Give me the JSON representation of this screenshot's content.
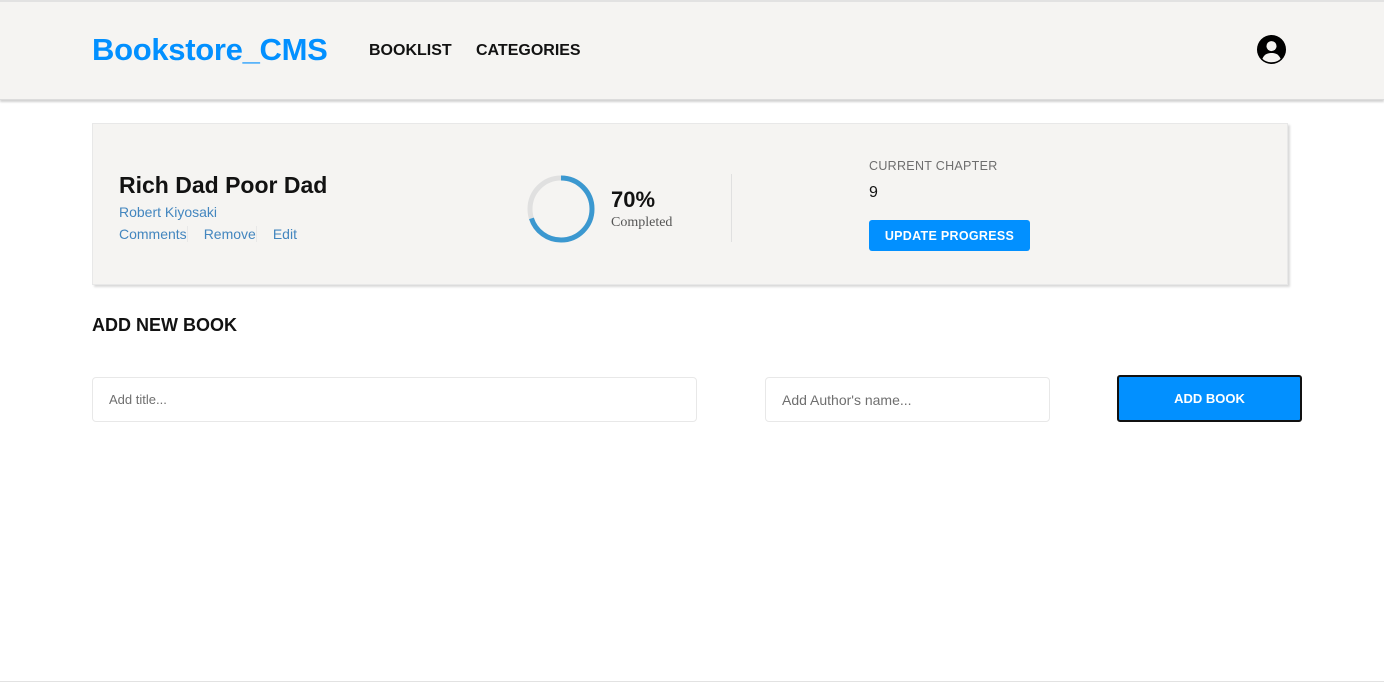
{
  "header": {
    "logo": "Bookstore_CMS",
    "nav": {
      "booklist": "BOOKLIST",
      "categories": "CATEGORIES"
    },
    "user_icon": "user-circle-icon"
  },
  "book": {
    "title": "Rich Dad Poor Dad",
    "author": "Robert Kiyosaki",
    "actions": {
      "comments": "Comments",
      "remove": "Remove",
      "edit": "Edit"
    },
    "progress": {
      "percent_text": "70%",
      "percent": 70,
      "label": "Completed"
    },
    "chapter": {
      "label": "CURRENT CHAPTER",
      "value": "9"
    },
    "update_button": "UPDATE PROGRESS"
  },
  "add_form": {
    "heading": "ADD NEW BOOK",
    "title_placeholder": "Add title...",
    "author_placeholder": "Add Author's name...",
    "submit_label": "ADD BOOK"
  },
  "colors": {
    "accent": "#0290ff",
    "link": "#4386bf",
    "progress": "#3b98d0",
    "track": "#e0e0e0"
  }
}
